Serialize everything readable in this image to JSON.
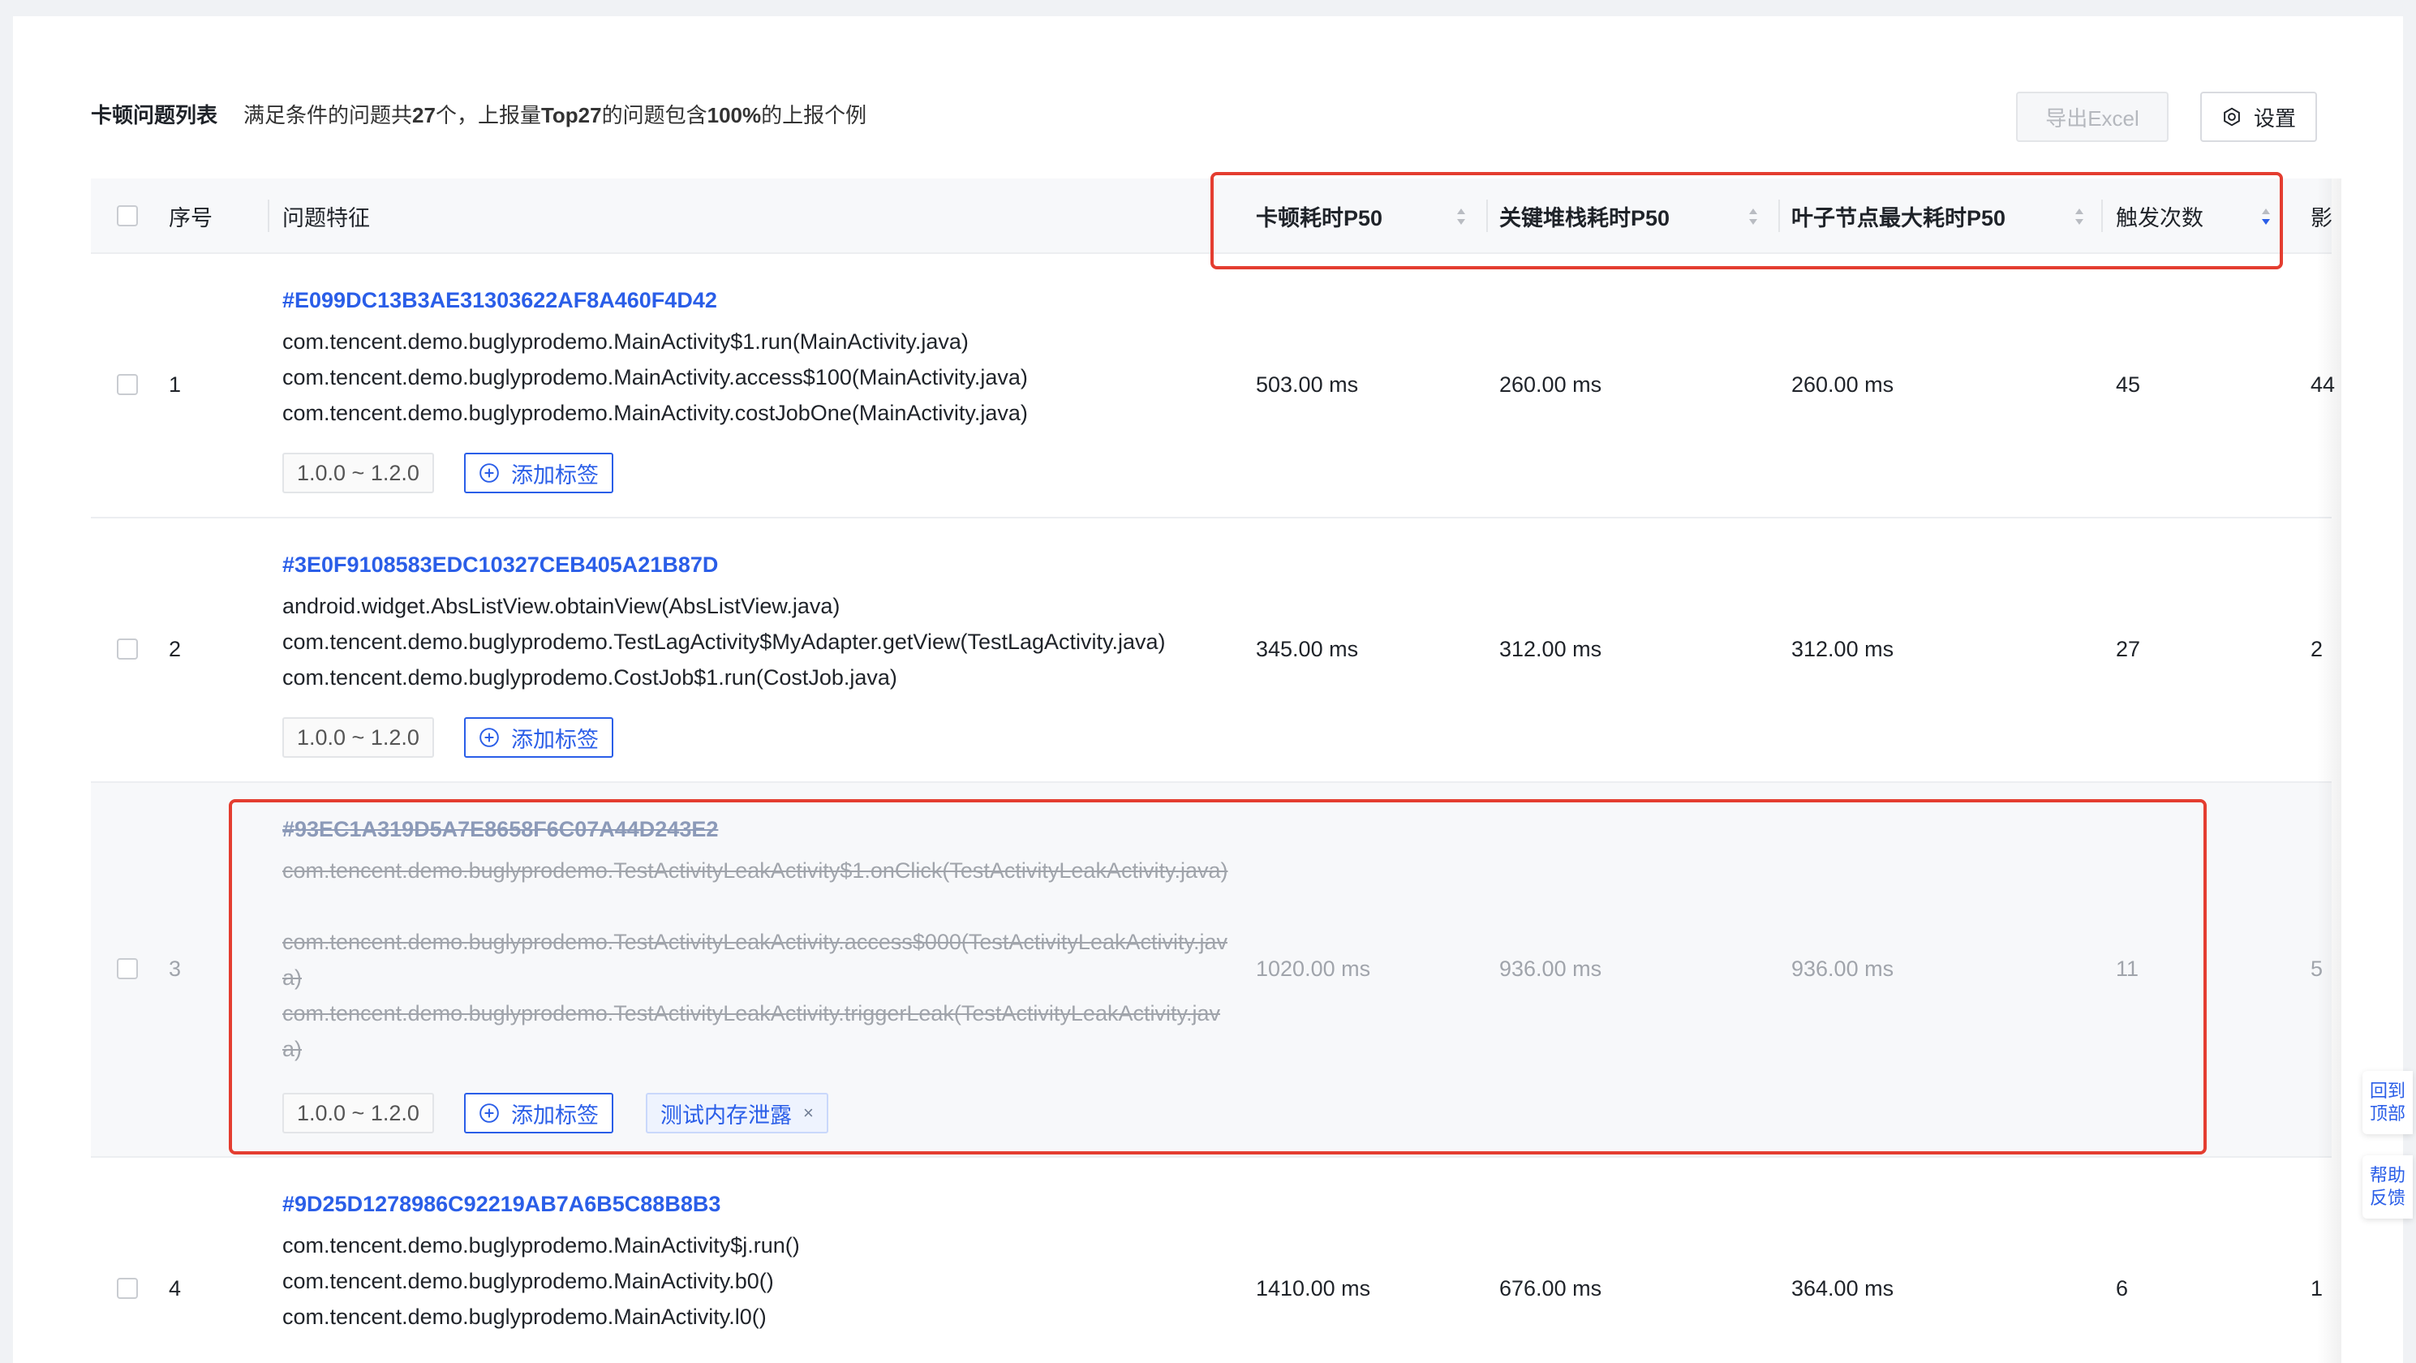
{
  "header": {
    "title": "卡顿问题列表",
    "summary_parts": [
      "满足条件的问题共",
      "27",
      "个，上报量",
      "Top27",
      "的问题包含",
      "100%",
      "的上报个例"
    ],
    "export_label": "导出Excel",
    "settings_label": "设置"
  },
  "columns": {
    "index": "序号",
    "feature": "问题特征",
    "lag_p50": "卡顿耗时P50",
    "stack_p50": "关键堆栈耗时P50",
    "leaf_p50": "叶子节点最大耗时P50",
    "trigger_count": "触发次数",
    "impact": "影"
  },
  "rows": [
    {
      "index": "1",
      "id": "#E099DC13B3AE31303622AF8A460F4D42",
      "stack": [
        "com.tencent.demo.buglyprodemo.MainActivity$1.run(MainActivity.java)",
        "com.tencent.demo.buglyprodemo.MainActivity.access$100(MainActivity.java)",
        "com.tencent.demo.buglyprodemo.MainActivity.costJobOne(MainActivity.java)"
      ],
      "version": "1.0.0 ~ 1.2.0",
      "add_tag": "添加标签",
      "lag_p50": "503.00 ms",
      "stack_p50": "260.00 ms",
      "leaf_p50": "260.00 ms",
      "trigger_count": "45",
      "impact": "44"
    },
    {
      "index": "2",
      "id": "#3E0F9108583EDC10327CEB405A21B87D",
      "stack": [
        "android.widget.AbsListView.obtainView(AbsListView.java)",
        "com.tencent.demo.buglyprodemo.TestLagActivity$MyAdapter.getView(TestLagActivity.java)",
        "com.tencent.demo.buglyprodemo.CostJob$1.run(CostJob.java)"
      ],
      "version": "1.0.0 ~ 1.2.0",
      "add_tag": "添加标签",
      "lag_p50": "345.00 ms",
      "stack_p50": "312.00 ms",
      "leaf_p50": "312.00 ms",
      "trigger_count": "27",
      "impact": "2"
    },
    {
      "index": "3",
      "id": "#93EC1A319D5A7E8658F6C07A44D243E2",
      "stack": [
        "com.tencent.demo.buglyprodemo.TestActivityLeakActivity$1.onClick(TestActivityLeakActivity.java)",
        "com.tencent.demo.buglyprodemo.TestActivityLeakActivity.access$000(TestActivityLeakActivity.java)",
        "com.tencent.demo.buglyprodemo.TestActivityLeakActivity.triggerLeak(TestActivityLeakActivity.java)"
      ],
      "version": "1.0.0 ~ 1.2.0",
      "add_tag": "添加标签",
      "label": "测试内存泄露",
      "label_close": "×",
      "lag_p50": "1020.00 ms",
      "stack_p50": "936.00 ms",
      "leaf_p50": "936.00 ms",
      "trigger_count": "11",
      "impact": "5"
    },
    {
      "index": "4",
      "id": "#9D25D1278986C92219AB7A6B5C88B8B3",
      "stack": [
        "com.tencent.demo.buglyprodemo.MainActivity$j.run()",
        "com.tencent.demo.buglyprodemo.MainActivity.b0()",
        "com.tencent.demo.buglyprodemo.MainActivity.l0()"
      ],
      "lag_p50": "1410.00 ms",
      "stack_p50": "676.00 ms",
      "leaf_p50": "364.00 ms",
      "trigger_count": "6",
      "impact": "1"
    }
  ],
  "float": {
    "back_to_top": "回到顶部",
    "feedback": "帮助反馈"
  },
  "colors": {
    "accent": "#2a5ee8",
    "highlight": "#e43d30",
    "header_bg": "#f7f8fa"
  },
  "icons": [
    "gear-icon",
    "plus-circle-icon",
    "sort-icon",
    "close-icon"
  ]
}
